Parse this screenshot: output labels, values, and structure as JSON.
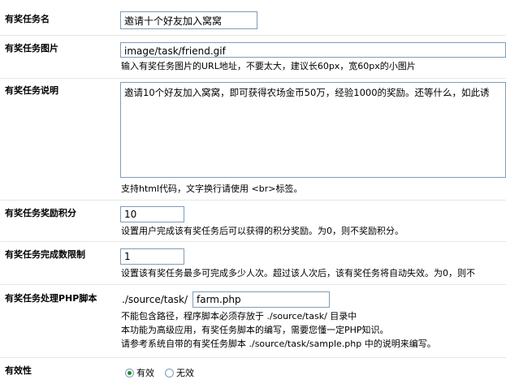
{
  "task_name": {
    "label": "有奖任务名",
    "value": "邀请十个好友加入窝窝"
  },
  "task_image": {
    "label": "有奖任务图片",
    "value": "image/task/friend.gif",
    "hint": "输入有奖任务图片的URL地址，不要太大，建议长60px，宽60px的小图片"
  },
  "task_desc": {
    "label": "有奖任务说明",
    "value": "邀请10个好友加入窝窝，即可获得农场金币50万，经验1000的奖励。还等什么，如此诱",
    "hint": "支持html代码，文字换行请使用 <br>标签。"
  },
  "task_reward": {
    "label": "有奖任务奖励积分",
    "value": "10",
    "hint": "设置用户完成该有奖任务后可以获得的积分奖励。为0，则不奖励积分。"
  },
  "task_limit": {
    "label": "有奖任务完成数限制",
    "value": "1",
    "hint": "设置该有奖任务最多可完成多少人次。超过该人次后，该有奖任务将自动失效。为0，则不"
  },
  "task_script": {
    "label": "有奖任务处理PHP脚本",
    "prefix": "./source/task/",
    "value": "farm.php",
    "hint1": "不能包含路径，程序脚本必须存放于 ./source/task/ 目录中",
    "hint2": "本功能为高级应用，有奖任务脚本的编写，需要您懂一定PHP知识。",
    "hint3": "请参考系统自带的有奖任务脚本 ./source/task/sample.php 中的说明来编写。"
  },
  "task_valid": {
    "label": "有效性",
    "option_valid": "有效",
    "option_invalid": "无效",
    "selected": "有效"
  },
  "colors": {
    "border": "#7f9db9",
    "separator": "#e6e6e6",
    "radio_checked": "#1f8a2e"
  }
}
